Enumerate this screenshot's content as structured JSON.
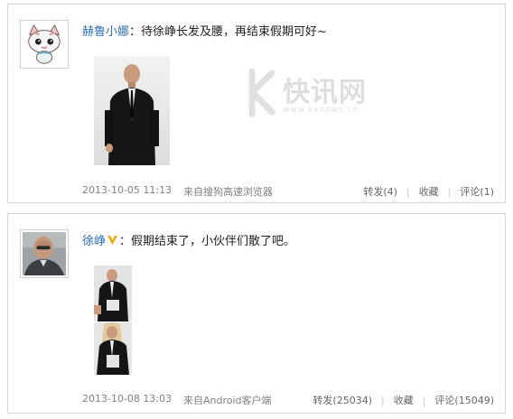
{
  "posts": [
    {
      "user": "赫鲁小娜",
      "colon": "：",
      "text": "待徐峥长发及腰，再结束假期可好~",
      "time": "2013-10-05 11:13",
      "source": "来自搜狗高速浏览器",
      "repost": "转发(4)",
      "favorite": "收藏",
      "comment": "评论(1)"
    },
    {
      "user": "徐峥",
      "colon": "：",
      "text": "假期结束了，小伙伴们散了吧。",
      "time": "2013-10-08 13:03",
      "source": "来自Android客户端",
      "repost": "转发(25034)",
      "favorite": "收藏",
      "comment": "评论(15049)"
    }
  ],
  "watermark": {
    "brand": "快讯网",
    "url": "www.kxnews.cn"
  },
  "colors": {
    "username": "#2a6eb5",
    "verified_badge": "#f0a800"
  }
}
